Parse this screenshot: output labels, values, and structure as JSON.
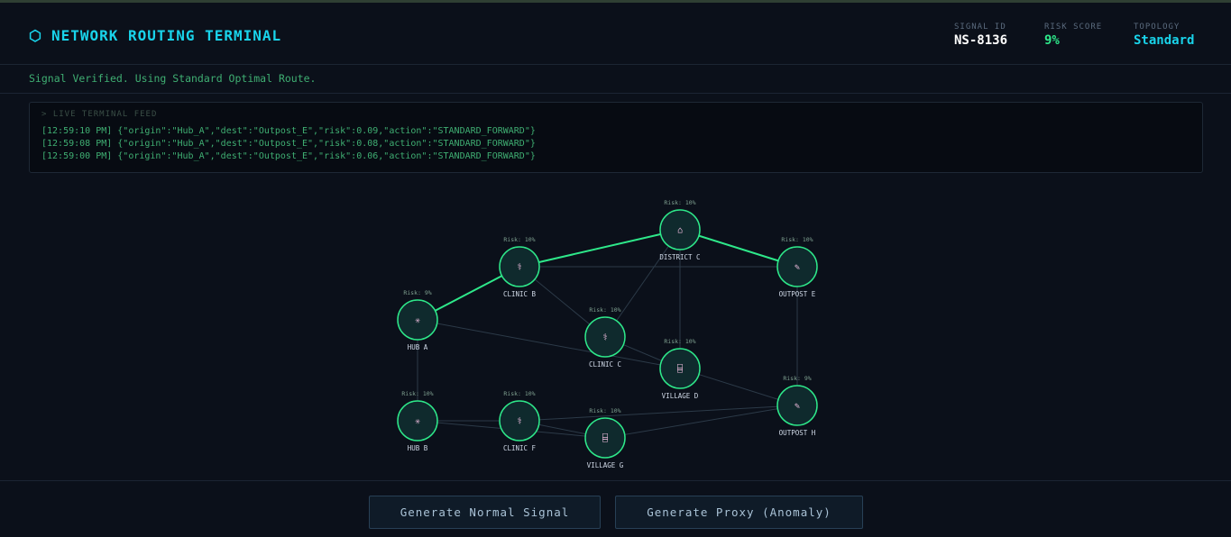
{
  "header": {
    "title_icon": "⬡",
    "title": "NETWORK ROUTING TERMINAL",
    "signal_id_label": "SIGNAL ID",
    "signal_id": "NS-8136",
    "risk_label": "RISK SCORE",
    "risk_value": "9%",
    "topology_label": "TOPOLOGY",
    "topology_value": "Standard"
  },
  "status": {
    "message": "Signal Verified. Using Standard Optimal Route."
  },
  "feed": {
    "title": "> LIVE TERMINAL FEED",
    "lines": [
      "[12:59:10 PM] {\"origin\":\"Hub_A\",\"dest\":\"Outpost_E\",\"risk\":0.09,\"action\":\"STANDARD_FORWARD\"}",
      "[12:59:08 PM] {\"origin\":\"Hub_A\",\"dest\":\"Outpost_E\",\"risk\":0.08,\"action\":\"STANDARD_FORWARD\"}",
      "[12:59:00 PM] {\"origin\":\"Hub_A\",\"dest\":\"Outpost_E\",\"risk\":0.06,\"action\":\"STANDARD_FORWARD\"}"
    ]
  },
  "graph": {
    "nodes": [
      {
        "id": "hub_a",
        "label": "HUB A",
        "risk": "Risk: 9%",
        "icon": "✳",
        "icon_name": "hub-icon"
      },
      {
        "id": "clinic_b",
        "label": "CLINIC B",
        "risk": "Risk: 10%",
        "icon": "⚕",
        "icon_name": "clinic-icon"
      },
      {
        "id": "district_c",
        "label": "DISTRICT C",
        "risk": "Risk: 10%",
        "icon": "⌂",
        "icon_name": "district-icon"
      },
      {
        "id": "outpost_e",
        "label": "OUTPOST E",
        "risk": "Risk: 10%",
        "icon": "✎",
        "icon_name": "outpost-icon"
      },
      {
        "id": "clinic_c",
        "label": "CLINIC C",
        "risk": "Risk: 10%",
        "icon": "⚕",
        "icon_name": "clinic-icon"
      },
      {
        "id": "village_d",
        "label": "VILLAGE D",
        "risk": "Risk: 10%",
        "icon": "⌸",
        "icon_name": "village-icon"
      },
      {
        "id": "outpost_h",
        "label": "OUTPOST H",
        "risk": "Risk: 9%",
        "icon": "✎",
        "icon_name": "outpost-icon"
      },
      {
        "id": "hub_b",
        "label": "HUB B",
        "risk": "Risk: 10%",
        "icon": "✳",
        "icon_name": "hub-icon"
      },
      {
        "id": "clinic_f",
        "label": "CLINIC F",
        "risk": "Risk: 10%",
        "icon": "⚕",
        "icon_name": "clinic-icon"
      },
      {
        "id": "village_g",
        "label": "VILLAGE G",
        "risk": "Risk: 10%",
        "icon": "⌸",
        "icon_name": "village-icon"
      }
    ],
    "edges": [
      {
        "from": "hub_a",
        "to": "clinic_b",
        "active": true
      },
      {
        "from": "clinic_b",
        "to": "district_c",
        "active": true
      },
      {
        "from": "district_c",
        "to": "outpost_e",
        "active": true
      },
      {
        "from": "clinic_b",
        "to": "outpost_e",
        "active": false
      },
      {
        "from": "clinic_b",
        "to": "clinic_c",
        "active": false
      },
      {
        "from": "district_c",
        "to": "clinic_c",
        "active": false
      },
      {
        "from": "district_c",
        "to": "village_d",
        "active": false
      },
      {
        "from": "hub_a",
        "to": "village_d",
        "active": false
      },
      {
        "from": "clinic_c",
        "to": "village_d",
        "active": false
      },
      {
        "from": "outpost_e",
        "to": "outpost_h",
        "active": false
      },
      {
        "from": "village_d",
        "to": "outpost_h",
        "active": false
      },
      {
        "from": "hub_a",
        "to": "hub_b",
        "active": false
      },
      {
        "from": "hub_b",
        "to": "clinic_f",
        "active": false
      },
      {
        "from": "hub_b",
        "to": "village_g",
        "active": false
      },
      {
        "from": "clinic_f",
        "to": "village_g",
        "active": false
      },
      {
        "from": "clinic_f",
        "to": "outpost_h",
        "active": false
      },
      {
        "from": "village_g",
        "to": "outpost_h",
        "active": false
      }
    ],
    "colors": {
      "node_fill": "#0f2a2d",
      "node_stroke": "#2ee88a",
      "active_edge": "#2ee88a",
      "edge": "#2c3a48",
      "label": "#cfd8e6",
      "risk_label": "#7fa090"
    }
  },
  "footer": {
    "normal_button": "Generate Normal Signal",
    "proxy_button": "Generate Proxy (Anomaly)"
  },
  "colors": {
    "accent": "#19d3ea",
    "success": "#2ee88a",
    "background": "#0b101a"
  }
}
